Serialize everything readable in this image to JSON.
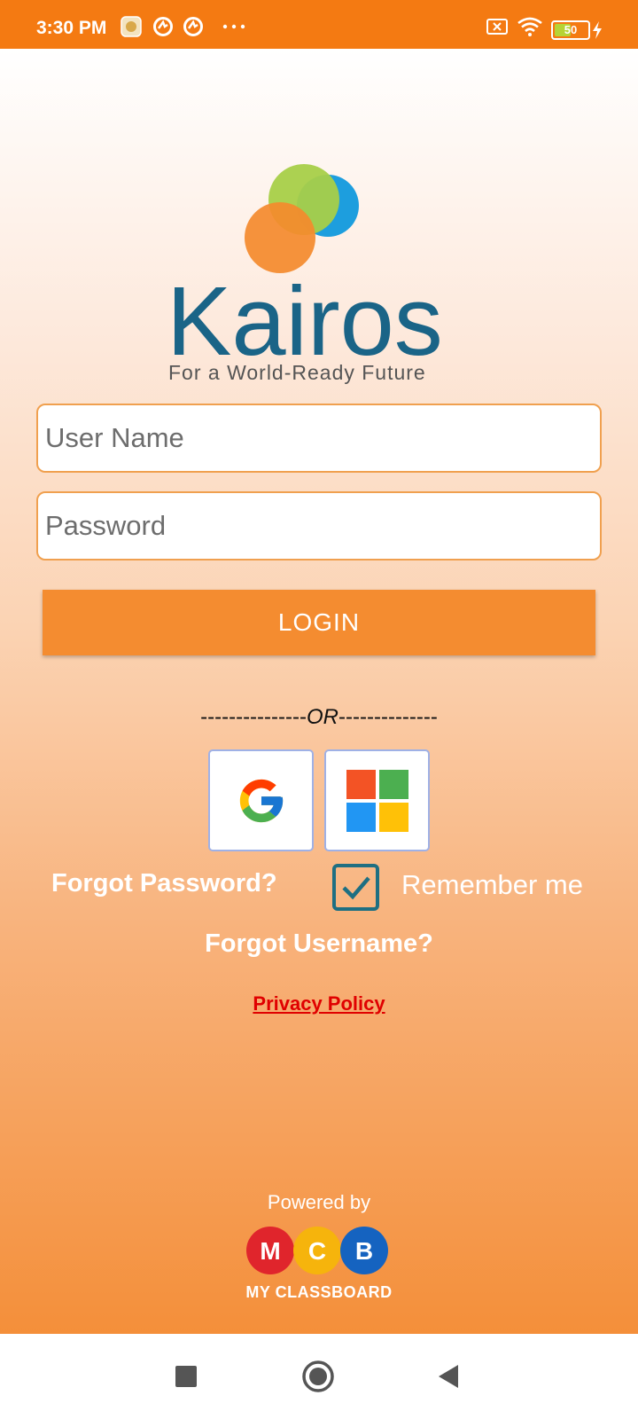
{
  "status_bar": {
    "time": "3:30 PM",
    "icons": [
      "notification-app-icon",
      "sync-icon",
      "sync-icon",
      "more-dots-icon",
      "no-sim-icon",
      "wifi-icon",
      "battery-icon",
      "charging-icon"
    ],
    "battery_level": "50",
    "battery_fraction": 0.5
  },
  "logo": {
    "brand_name": "Kairos",
    "tagline": "For a World-Ready Future"
  },
  "login_form": {
    "username_placeholder": "User Name",
    "password_placeholder": "Password",
    "login_label": "LOGIN",
    "or_left": "---------------",
    "or_text": "OR",
    "or_right": "--------------",
    "sso_buttons": [
      "google-icon",
      "microsoft-icon"
    ],
    "forgot_password": "Forgot Password?",
    "remember_me": "Remember me",
    "remember_checked": true,
    "forgot_username": "Forgot Username?",
    "privacy_policy": "Privacy Policy"
  },
  "footer": {
    "powered_by": "Powered by",
    "mcb_letters": [
      "M",
      "C",
      "B"
    ],
    "mcb_name": "MY CLASSBOARD"
  },
  "nav_bar": {
    "buttons": [
      "recents-icon",
      "home-icon",
      "back-icon"
    ]
  },
  "colors": {
    "status_bar": "#f47a12",
    "accent_orange": "#f48c30",
    "field_border": "#f0a04f",
    "privacy_red": "#e00000",
    "checkbox_teal": "#1e6f82",
    "kairos_blue": "#1a6487"
  }
}
